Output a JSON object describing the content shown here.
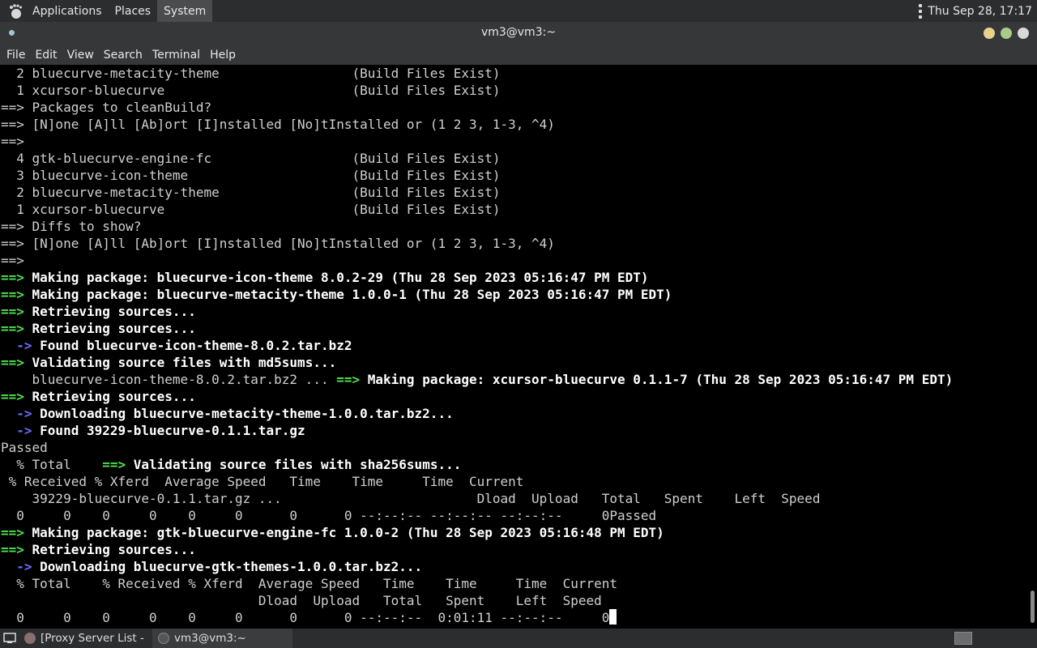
{
  "top_panel": {
    "menus": [
      "Applications",
      "Places",
      "System"
    ],
    "clock": "Thu Sep 28, 17:17"
  },
  "window": {
    "title": "vm3@vm3:~"
  },
  "menubar": {
    "items": [
      "File",
      "Edit",
      "View",
      "Search",
      "Terminal",
      "Help"
    ]
  },
  "terminal": {
    "colors": {
      "green_arrow": "#4ee04e",
      "blue_arrow": "#6a6aff"
    },
    "lines": [
      [
        {
          "t": "  2 bluecurve-metacity-theme                 (Build Files Exist)"
        }
      ],
      [
        {
          "t": "  1 xcursor-bluecurve                        (Build Files Exist)"
        }
      ],
      [
        {
          "t": "==> Packages to cleanBuild?"
        }
      ],
      [
        {
          "t": "==> [N]one [A]ll [Ab]ort [I]nstalled [No]tInstalled or (1 2 3, 1-3, ^4)"
        }
      ],
      [
        {
          "t": "==>"
        }
      ],
      [
        {
          "t": "  4 gtk-bluecurve-engine-fc                  (Build Files Exist)"
        }
      ],
      [
        {
          "t": "  3 bluecurve-icon-theme                     (Build Files Exist)"
        }
      ],
      [
        {
          "t": "  2 bluecurve-metacity-theme                 (Build Files Exist)"
        }
      ],
      [
        {
          "t": "  1 xcursor-bluecurve                        (Build Files Exist)"
        }
      ],
      [
        {
          "t": "==> Diffs to show?"
        }
      ],
      [
        {
          "t": "==> [N]one [A]ll [Ab]ort [I]nstalled [No]tInstalled or (1 2 3, 1-3, ^4)"
        }
      ],
      [
        {
          "t": "==>"
        }
      ],
      [
        {
          "t": "==>",
          "s": "g"
        },
        {
          "t": " Making package: bluecurve-icon-theme 8.0.2-29 (Thu 28 Sep 2023 05:16:47 PM EDT)",
          "s": "b"
        }
      ],
      [
        {
          "t": "==>",
          "s": "g"
        },
        {
          "t": " Making package: bluecurve-metacity-theme 1.0.0-1 (Thu 28 Sep 2023 05:16:47 PM EDT)",
          "s": "b"
        }
      ],
      [
        {
          "t": "==>",
          "s": "g"
        },
        {
          "t": " Retrieving sources...",
          "s": "b"
        }
      ],
      [
        {
          "t": "==>",
          "s": "g"
        },
        {
          "t": " Retrieving sources...",
          "s": "b"
        }
      ],
      [
        {
          "t": "  "
        },
        {
          "t": "->",
          "s": "u"
        },
        {
          "t": " Found bluecurve-icon-theme-8.0.2.tar.bz2",
          "s": "b"
        }
      ],
      [
        {
          "t": "==>",
          "s": "g"
        },
        {
          "t": " Validating source files with md5sums...",
          "s": "b"
        }
      ],
      [
        {
          "t": "    bluecurve-icon-theme-8.0.2.tar.bz2 ... "
        },
        {
          "t": "==>",
          "s": "g"
        },
        {
          "t": " Making package: xcursor-bluecurve 0.1.1-7 (Thu 28 Sep 2023 05:16:47 PM EDT)",
          "s": "b"
        }
      ],
      [
        {
          "t": "==>",
          "s": "g"
        },
        {
          "t": " Retrieving sources...",
          "s": "b"
        }
      ],
      [
        {
          "t": "  "
        },
        {
          "t": "->",
          "s": "u"
        },
        {
          "t": " Downloading bluecurve-metacity-theme-1.0.0.tar.bz2...",
          "s": "b"
        }
      ],
      [
        {
          "t": "  "
        },
        {
          "t": "->",
          "s": "u"
        },
        {
          "t": " Found 39229-bluecurve-0.1.1.tar.gz",
          "s": "b"
        }
      ],
      [
        {
          "t": "Passed"
        }
      ],
      [
        {
          "t": "  % Total    "
        },
        {
          "t": "==>",
          "s": "g"
        },
        {
          "t": " Validating source files with sha256sums...",
          "s": "b"
        }
      ],
      [
        {
          "t": " % Received % Xferd  Average Speed   Time    Time     Time  Current"
        }
      ],
      [
        {
          "t": "    39229-bluecurve-0.1.1.tar.gz ...                         Dload  Upload   Total   Spent    Left  Speed"
        }
      ],
      [
        {
          "t": "  0     0    0     0    0     0      0      0 --:--:-- --:--:-- --:--:--     0Passed"
        }
      ],
      [
        {
          "t": "==>",
          "s": "g"
        },
        {
          "t": " Making package: gtk-bluecurve-engine-fc 1.0.0-2 (Thu 28 Sep 2023 05:16:48 PM EDT)",
          "s": "b"
        }
      ],
      [
        {
          "t": "==>",
          "s": "g"
        },
        {
          "t": " Retrieving sources...",
          "s": "b"
        }
      ],
      [
        {
          "t": "  "
        },
        {
          "t": "->",
          "s": "u"
        },
        {
          "t": " Downloading bluecurve-gtk-themes-1.0.0.tar.bz2...",
          "s": "b"
        }
      ],
      [
        {
          "t": "  % Total    % Received % Xferd  Average Speed   Time    Time     Time  Current"
        }
      ],
      [
        {
          "t": "                                 Dload  Upload   Total   Spent    Left  Speed"
        }
      ],
      [
        {
          "t": "  0     0    0     0    0     0      0      0 --:--:--  0:01:11 --:--:--     0"
        }
      ]
    ]
  },
  "taskbar": {
    "tasks": [
      {
        "label": "[Proxy Server List - j..."
      },
      {
        "label": "vm3@vm3:~"
      }
    ]
  }
}
